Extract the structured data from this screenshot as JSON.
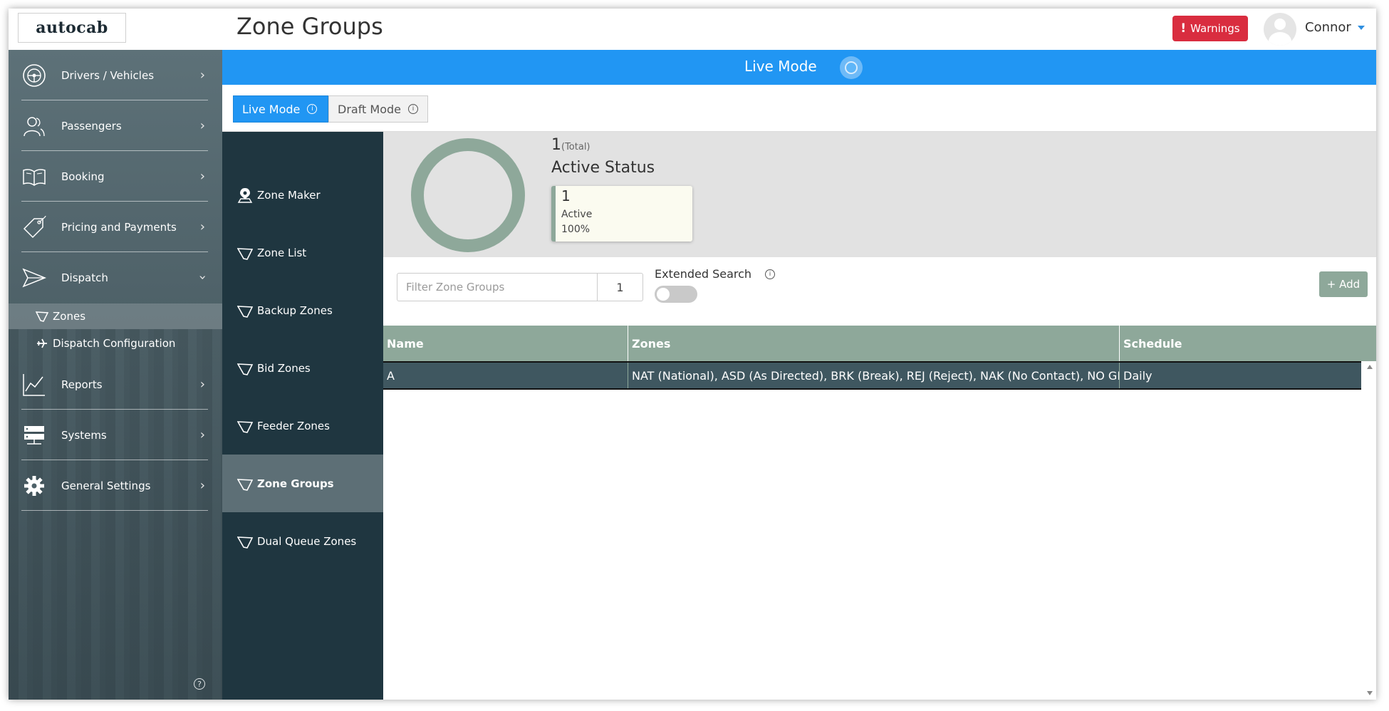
{
  "header": {
    "logo": "autocab",
    "title": "Zone Groups",
    "warnings_label": "Warnings",
    "user_name": "Connor"
  },
  "sidebar": {
    "items": [
      {
        "label": "Drivers / Vehicles",
        "icon": "steering-wheel-icon"
      },
      {
        "label": "Passengers",
        "icon": "users-icon"
      },
      {
        "label": "Booking",
        "icon": "book-icon"
      },
      {
        "label": "Pricing and Payments",
        "icon": "tag-icon"
      },
      {
        "label": "Dispatch",
        "icon": "paper-plane-icon"
      },
      {
        "label": "Reports",
        "icon": "line-chart-icon"
      },
      {
        "label": "Systems",
        "icon": "server-icon"
      },
      {
        "label": "General Settings",
        "icon": "gear-icon"
      }
    ],
    "dispatch_sub": [
      {
        "label": "Zones",
        "icon": "zone-icon"
      },
      {
        "label": "Dispatch Configuration",
        "icon": "plane-icon"
      }
    ]
  },
  "banner": {
    "label": "Live Mode"
  },
  "modes": {
    "live": "Live Mode",
    "draft": "Draft Mode"
  },
  "subnav": {
    "items": [
      {
        "label": "Zone Maker"
      },
      {
        "label": "Zone List"
      },
      {
        "label": "Backup Zones"
      },
      {
        "label": "Bid Zones"
      },
      {
        "label": "Feeder Zones"
      },
      {
        "label": "Zone Groups"
      },
      {
        "label": "Dual Queue Zones"
      }
    ]
  },
  "stats": {
    "total_value": "1",
    "total_label": "(Total)",
    "status_title": "Active Status",
    "card": {
      "value": "1",
      "label": "Active",
      "percent": "100%"
    },
    "donut_color": "#8ea89a"
  },
  "filter": {
    "placeholder": "Filter Zone Groups",
    "count": "1",
    "extended_search_label": "Extended Search",
    "extended_search_on": false,
    "add_label": "+ Add"
  },
  "table": {
    "columns": [
      "Name",
      "Zones",
      "Schedule"
    ],
    "rows": [
      {
        "name": "A",
        "zones": "NAT (National), ASD (As Directed), BRK (Break), REJ (Reject), NAK (No Contact), NO GPS (No GPS)",
        "schedule": "Daily"
      }
    ]
  },
  "colors": {
    "accent_blue": "#2196f3",
    "warning_red": "#d92d3f",
    "sage": "#8ea89a",
    "row_selected": "#3f5760",
    "subnav_bg": "#1f3640"
  }
}
